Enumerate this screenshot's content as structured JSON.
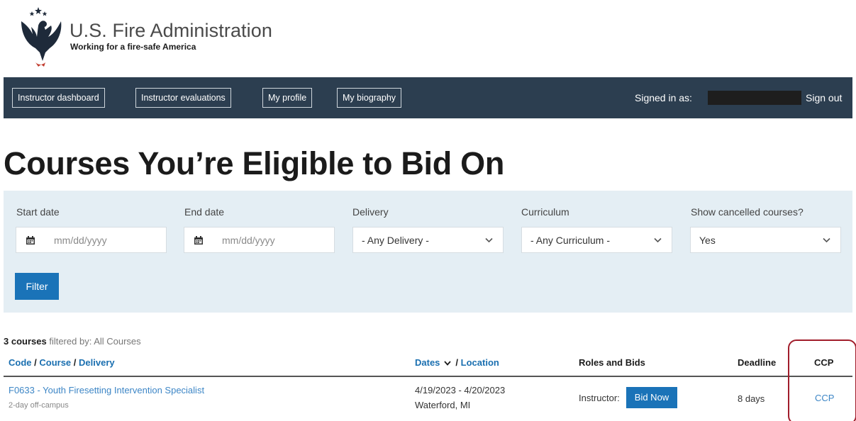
{
  "brand": {
    "title": "U.S. Fire Administration",
    "tagline": "Working for a fire-safe America"
  },
  "nav": {
    "items": [
      {
        "label": "Instructor dashboard"
      },
      {
        "label": "Instructor evaluations"
      },
      {
        "label": "My profile"
      },
      {
        "label": "My biography"
      }
    ],
    "signed_in_label": "Signed in as:",
    "sign_out_label": "Sign out"
  },
  "page": {
    "title": "Courses You’re Eligible to Bid On"
  },
  "filters": {
    "start_date": {
      "label": "Start date",
      "placeholder": "mm/dd/yyyy"
    },
    "end_date": {
      "label": "End date",
      "placeholder": "mm/dd/yyyy"
    },
    "delivery": {
      "label": "Delivery",
      "value": "- Any Delivery -"
    },
    "curriculum": {
      "label": "Curriculum",
      "value": "- Any Curriculum -"
    },
    "cancelled": {
      "label": "Show cancelled courses?",
      "value": "Yes"
    },
    "submit_label": "Filter"
  },
  "results": {
    "count": "3 courses",
    "filter_text": "filtered by: All Courses",
    "columns": {
      "code": "Code",
      "sep1": "/",
      "course": "Course",
      "sep2": "/",
      "delivery": "Delivery",
      "dates": "Dates",
      "sep3": "/",
      "location": "Location",
      "roles": "Roles and Bids",
      "deadline": "Deadline",
      "ccp": "CCP"
    },
    "rows": [
      {
        "course": "F0633 - Youth Firesetting Intervention Specialist",
        "delivery": "2-day off-campus",
        "dates": "4/19/2023 - 4/20/2023",
        "location": "Waterford, MI",
        "role": "Instructor:",
        "bid_label": "Bid Now",
        "deadline": "8 days",
        "ccp": "CCP"
      }
    ]
  },
  "colors": {
    "navbar": "#2c3e50",
    "filter_panel": "#e4eef4",
    "primary_button": "#1a73b8",
    "link": "#1a6fb0",
    "highlight": "#a11d2b"
  }
}
